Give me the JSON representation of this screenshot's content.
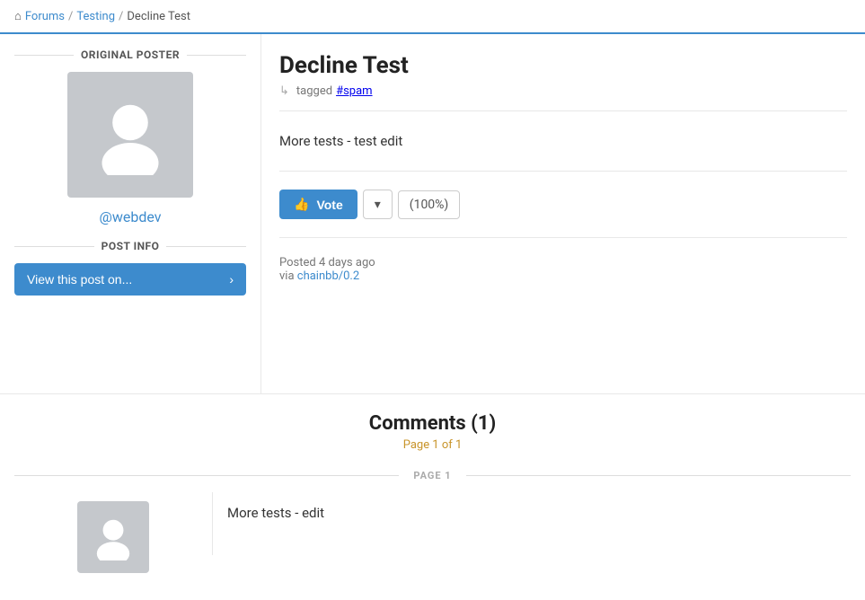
{
  "breadcrumb": {
    "home_label": "Forums",
    "sep1": "/",
    "section_label": "Testing",
    "sep2": "/",
    "current_label": "Decline Test"
  },
  "sidebar": {
    "original_poster_label": "ORIGINAL POSTER",
    "username": "@webdev",
    "post_info_label": "POST INFO",
    "view_post_btn_label": "View this post on..."
  },
  "post": {
    "title": "Decline Test",
    "tagged_prefix": "tagged",
    "tag": "#spam",
    "body": "More tests - test edit",
    "vote_label": "Vote",
    "vote_percent": "(100%)",
    "posted_time": "Posted 4 days ago",
    "via_label": "via chainbb/0.2",
    "via_link": "chainbb/0.2"
  },
  "comments": {
    "title": "Comments (1)",
    "pagination": "Page 1 of 1",
    "page_label": "PAGE 1",
    "items": [
      {
        "body": "More tests - edit"
      }
    ]
  }
}
